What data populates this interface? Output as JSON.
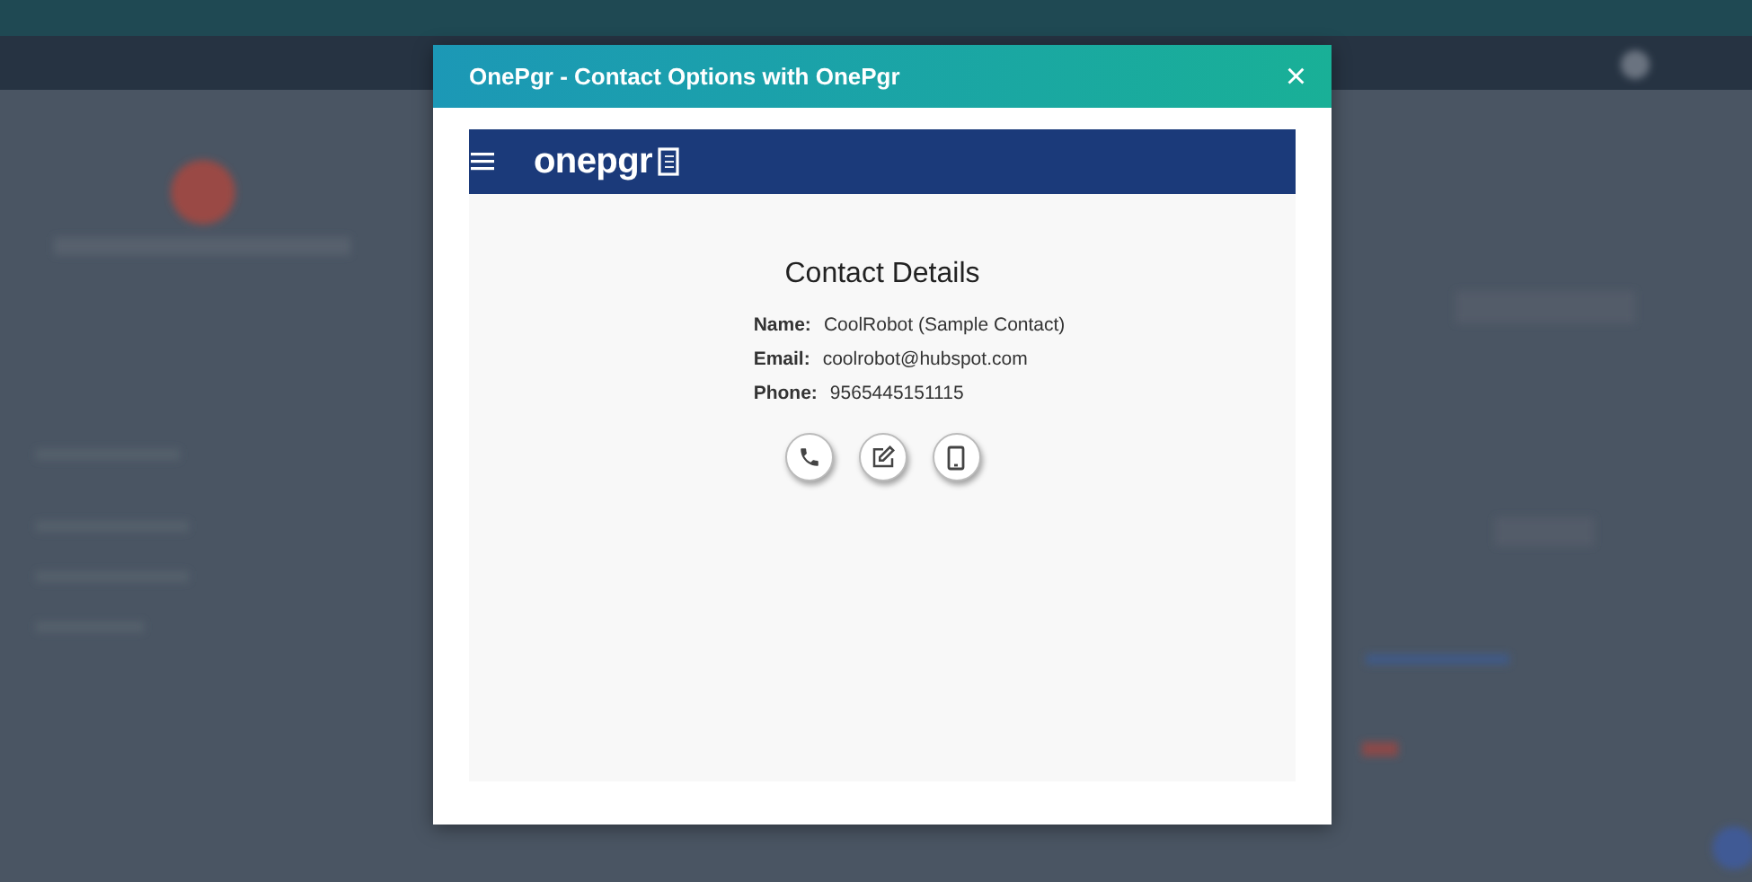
{
  "dialog": {
    "title": "OnePgr - Contact Options with OnePgr",
    "close_label": "×"
  },
  "app": {
    "brand": "onepgr",
    "heading": "Contact Details",
    "fields": [
      {
        "label": "Name:",
        "value": "CoolRobot (Sample Contact)"
      },
      {
        "label": "Email:",
        "value": "coolrobot@hubspot.com"
      },
      {
        "label": "Phone:",
        "value": "9565445151115"
      }
    ],
    "actions": [
      {
        "kind": "call"
      },
      {
        "kind": "note"
      },
      {
        "kind": "mobile"
      }
    ]
  }
}
